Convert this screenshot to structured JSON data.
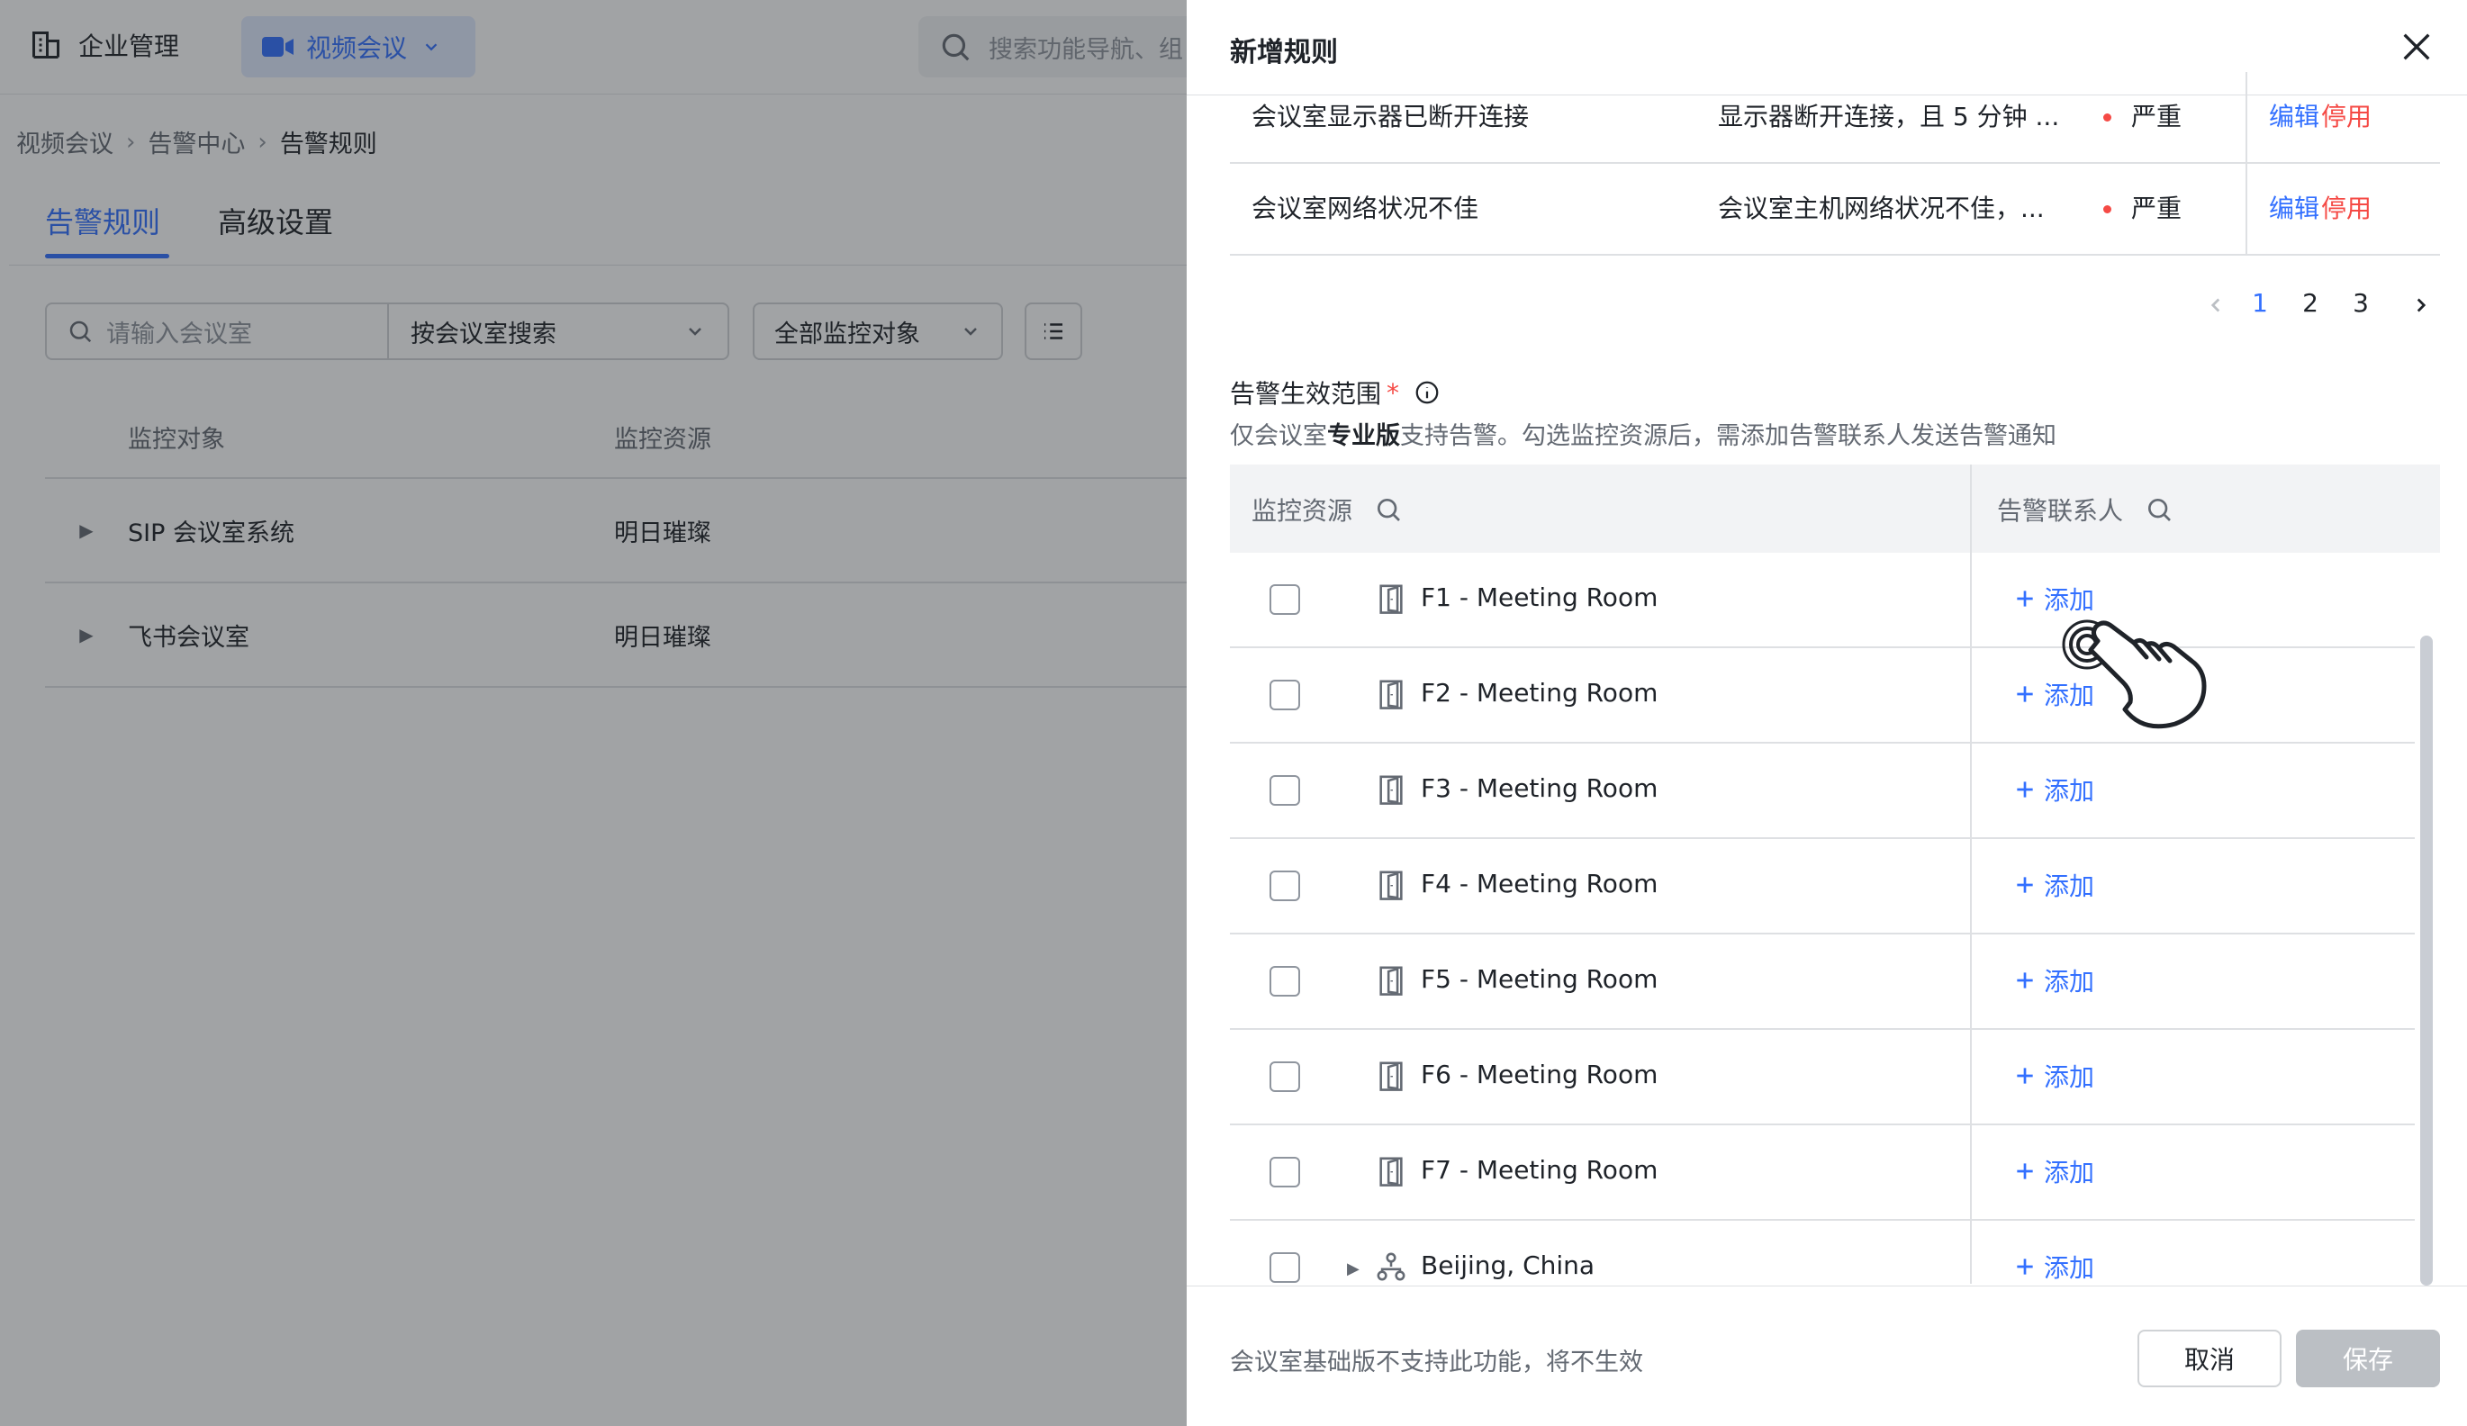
{
  "topbar": {
    "brand_label": "企业管理",
    "app_label": "视频会议",
    "search_placeholder": "搜索功能导航、组"
  },
  "breadcrumb": [
    "视频会议",
    "告警中心",
    "告警规则"
  ],
  "tabs": [
    "告警规则",
    "高级设置"
  ],
  "filters": {
    "search_placeholder": "请输入会议室",
    "search_mode": "按会议室搜索",
    "object_filter": "全部监控对象"
  },
  "bg_table": {
    "headers": [
      "监控对象",
      "监控资源"
    ],
    "rows": [
      {
        "object": "SIP 会议室系统",
        "resource": "明日璀璨"
      },
      {
        "object": "飞书会议室",
        "resource": "明日璀璨"
      }
    ]
  },
  "drawer": {
    "title": "新增规则",
    "rules": [
      {
        "name": "会议室显示器已断开连接",
        "condition": "显示器断开连接，且 5 分钟 ...",
        "level": "严重",
        "edit": "编辑",
        "disable": "停用"
      },
      {
        "name": "会议室网络状况不佳",
        "condition": "会议室主机网络状况不佳，...",
        "level": "严重",
        "edit": "编辑",
        "disable": "停用"
      }
    ],
    "pagination": {
      "pages": [
        "1",
        "2",
        "3"
      ],
      "current": "1"
    },
    "scope": {
      "label": "告警生效范围",
      "required_mark": "*",
      "desc_prefix": "仅会议室",
      "desc_bold": "专业版",
      "desc_suffix": "支持告警。勾选监控资源后，需添加告警联系人发送告警通知"
    },
    "grid": {
      "col_resource": "监控资源",
      "col_contact": "告警联系人",
      "add_label": "添加",
      "rows": [
        {
          "name": "F1 - Meeting Room",
          "type": "room"
        },
        {
          "name": "F2 - Meeting Room",
          "type": "room"
        },
        {
          "name": "F3 - Meeting Room",
          "type": "room"
        },
        {
          "name": "F4 - Meeting Room",
          "type": "room"
        },
        {
          "name": "F5 - Meeting Room",
          "type": "room"
        },
        {
          "name": "F6 - Meeting Room",
          "type": "room"
        },
        {
          "name": "F7 - Meeting Room",
          "type": "room"
        },
        {
          "name": "Beijing, China",
          "type": "location"
        }
      ]
    },
    "footer": {
      "note": "会议室基础版不支持此功能，将不生效",
      "cancel": "取消",
      "save": "保存"
    }
  },
  "colors": {
    "primary": "#3370ff",
    "danger": "#f54a45",
    "disabled": "#bbbfc4"
  }
}
